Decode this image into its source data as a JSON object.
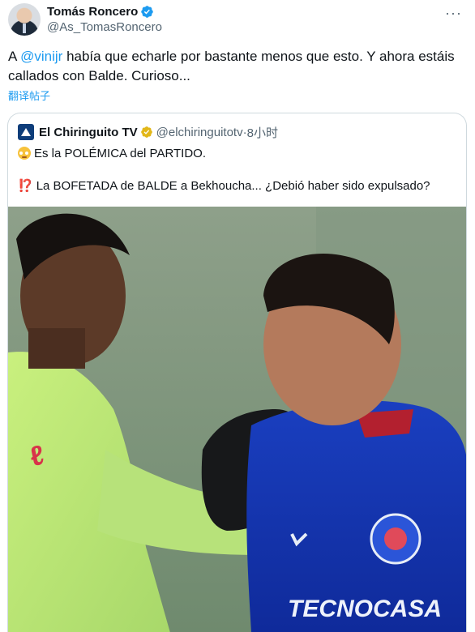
{
  "tweet": {
    "author_name": "Tomás Roncero",
    "author_handle": "@As_TomasRoncero",
    "text_prefix": "A ",
    "mention": "@vinijr",
    "text_suffix": " había que echarle por bastante menos que esto. Y ahora estáis callados con Balde. Curioso...",
    "translate_label": "翻译帖子",
    "more_icon": "more-dots-icon"
  },
  "quote": {
    "author_name": "El Chiringuito TV",
    "author_handle": "@elchiringuitotv",
    "separator": " · ",
    "time": "8小时",
    "line1_emoji": "flushed-face-icon",
    "line1": "Es la POLÉMICA del PARTIDO.",
    "line2_emoji": "⁉️",
    "line2": "La BOFETADA de BALDE a Bekhoucha... ¿Debió haber sido expulsado?"
  },
  "media": {
    "jersey_text": "TECNOCASA"
  },
  "colors": {
    "accent": "#1d9bf0",
    "text": "#0f1419",
    "secondary": "#536471",
    "verified_blue": "#1d9bf0",
    "verified_gold": "#e2b719"
  }
}
